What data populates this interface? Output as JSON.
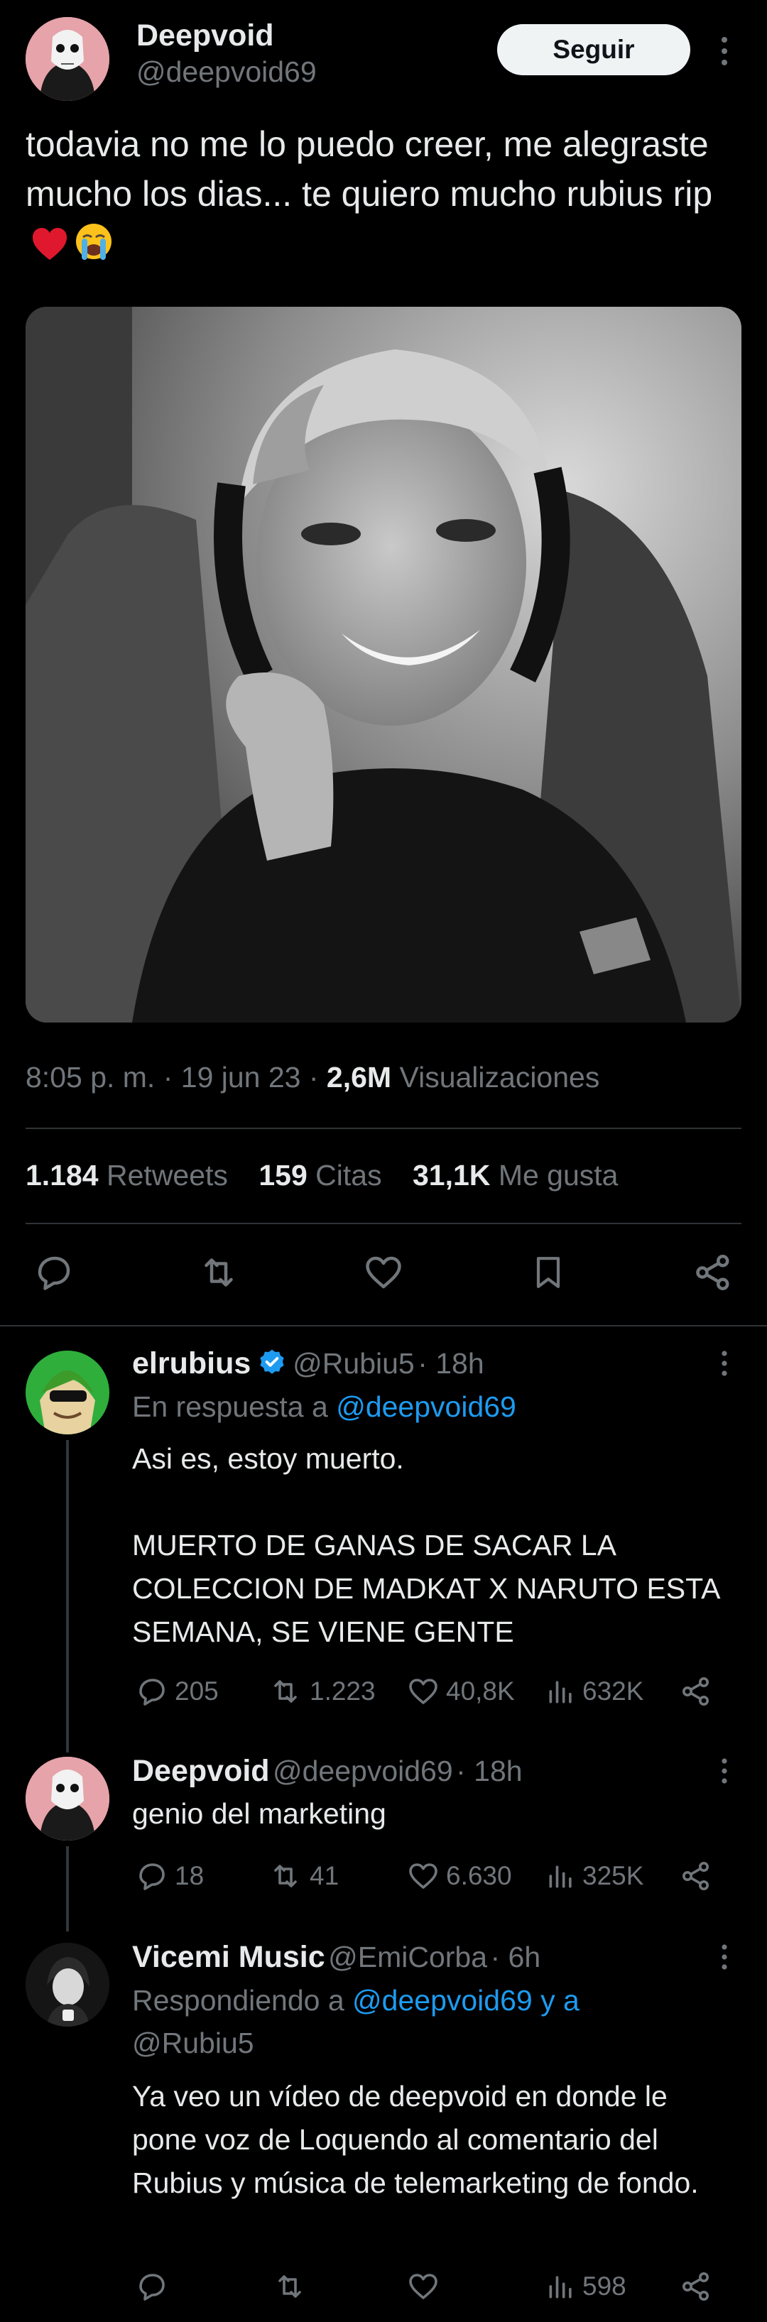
{
  "main_tweet": {
    "display_name": "Deepvoid",
    "handle": "@deepvoid69",
    "follow_label": "Seguir",
    "text": "todavia no me lo puedo creer, me alegraste mucho los dias... te quiero mucho rubius rip",
    "time": "8:05 p. m.",
    "date": "19 jun 23",
    "views_count": "2,6M",
    "views_label": "Visualizaciones",
    "retweets_count": "1.184",
    "retweets_label": "Retweets",
    "quotes_count": "159",
    "quotes_label": "Citas",
    "likes_count": "31,1K",
    "likes_label": "Me gusta",
    "actions": [
      "reply-icon",
      "retweet-icon",
      "like-icon",
      "bookmark-icon",
      "share-icon"
    ]
  },
  "replies": [
    {
      "display_name": "elrubius",
      "verified": true,
      "handle": "@Rubiu5",
      "time": "· 18h",
      "reply_prefix": "En respuesta a",
      "reply_to": "@deepvoid69",
      "body": "Asi es, estoy muerto.\n\nMUERTO DE GANAS DE SACAR LA COLECCION DE MADKAT X NARUTO ESTA SEMANA, SE VIENE GENTE",
      "replies": "205",
      "retweets": "1.223",
      "likes": "40,8K",
      "views": "632K"
    },
    {
      "display_name": "Deepvoid",
      "handle": "@deepvoid69",
      "time": "· 18h",
      "body": "genio del marketing",
      "replies": "18",
      "retweets": "41",
      "likes": "6.630",
      "views": "325K"
    },
    {
      "display_name": "Vicemi Music",
      "handle": "@EmiCorba",
      "time": "· 6h",
      "reply_prefix": "Respondiendo a",
      "reply_to_line1": "@deepvoid69 y a",
      "reply_to_line2": "@Rubiu5",
      "body": "Ya veo un vídeo de deepvoid en donde le pone voz de Loquendo al comentario del Rubius y música de telemarketing de fondo.",
      "views": "598"
    }
  ],
  "colors": {
    "background": "#000000",
    "text": "#e7e9ea",
    "muted": "#71767b",
    "link": "#1d9bf0",
    "divider": "#2f3336",
    "heart": "#f91880"
  }
}
